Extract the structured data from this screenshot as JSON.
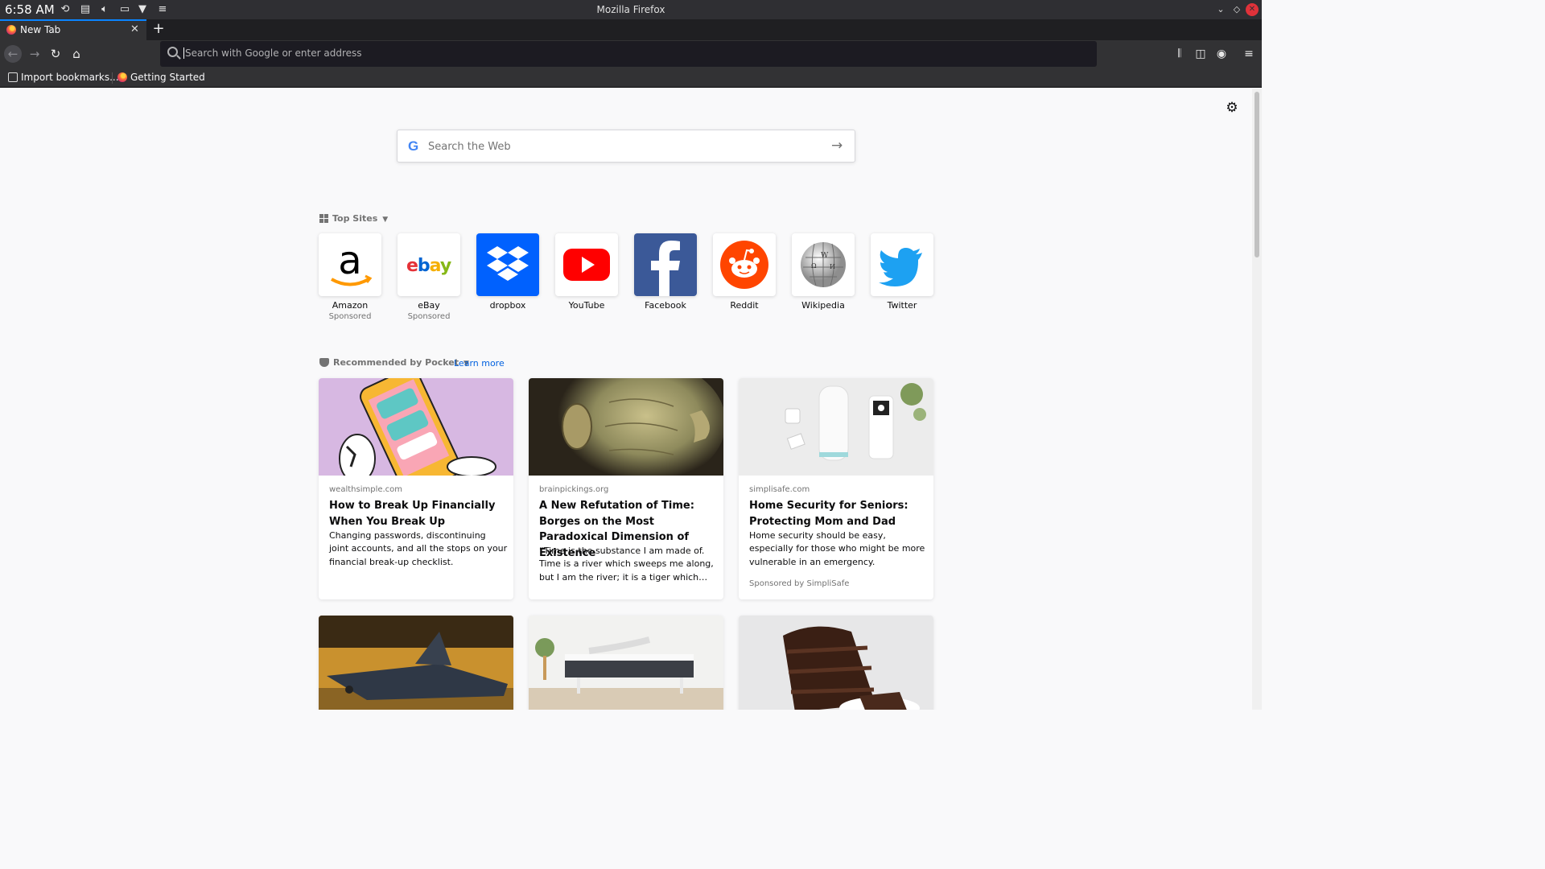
{
  "os": {
    "time": "6:58 AM",
    "window_title": "Mozilla Firefox"
  },
  "tabs": [
    {
      "label": "New Tab"
    }
  ],
  "urlbar": {
    "placeholder": "Search with Google or enter address"
  },
  "bookmarks": [
    {
      "label": "Import bookmarks..."
    },
    {
      "label": "Getting Started"
    }
  ],
  "newtab": {
    "search_placeholder": "Search the Web",
    "search_logo": "G",
    "top_sites_heading": "Top Sites",
    "pocket_heading": "Recommended by Pocket",
    "learn_more": "Learn more",
    "top_sites": [
      {
        "title": "Amazon",
        "sponsored": "Sponsored",
        "icon": "amazon-logo",
        "color": "#ff9900"
      },
      {
        "title": "eBay",
        "sponsored": "Sponsored",
        "icon": "ebay-logo",
        "color": "#e53238"
      },
      {
        "title": "dropbox",
        "sponsored": "",
        "icon": "dropbox-logo",
        "color": "#0061fe"
      },
      {
        "title": "YouTube",
        "sponsored": "",
        "icon": "youtube-logo",
        "color": "#ff0000"
      },
      {
        "title": "Facebook",
        "sponsored": "",
        "icon": "facebook-logo",
        "color": "#3b5998"
      },
      {
        "title": "Reddit",
        "sponsored": "",
        "icon": "reddit-logo",
        "color": "#ff4500"
      },
      {
        "title": "Wikipedia",
        "sponsored": "",
        "icon": "wikipedia-logo",
        "color": "#999999"
      },
      {
        "title": "Twitter",
        "sponsored": "",
        "icon": "twitter-logo",
        "color": "#1da1f2"
      }
    ],
    "stories": [
      {
        "source": "wealthsimple.com",
        "title": "How to Break Up Financially When You Break Up",
        "excerpt": "Changing passwords, discontinuing joint accounts, and all the stops on your financial break-up checklist.",
        "sponsor": ""
      },
      {
        "source": "brainpickings.org",
        "title": "A New Refutation of Time: Borges on the Most Paradoxical Dimension of Existence",
        "excerpt": "“Time is the substance I am made of. Time is a river which sweeps me along, but I am the river; it is a tiger which…",
        "sponsor": ""
      },
      {
        "source": "simplisafe.com",
        "title": "Home Security for Seniors: Protecting Mom and Dad",
        "excerpt": "Home security should be easy, especially for those who might be more vulnerable in an emergency.",
        "sponsor": "Sponsored by SimpliSafe"
      }
    ]
  },
  "colors": {
    "accent": "#0a84ff",
    "link": "#0060df",
    "toolbar": "#323234"
  }
}
